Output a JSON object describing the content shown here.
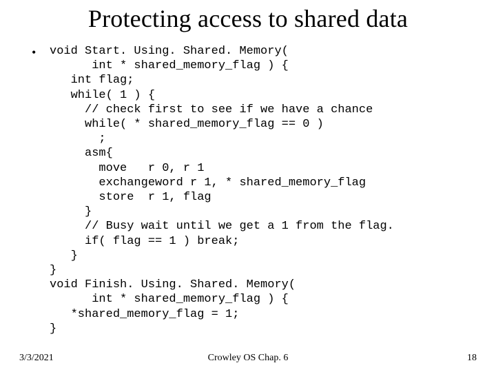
{
  "title": "Protecting access to shared data",
  "bullet": "•",
  "code": "void Start. Using. Shared. Memory(\n      int * shared_memory_flag ) {\n   int flag;\n   while( 1 ) {\n     // check first to see if we have a chance\n     while( * shared_memory_flag == 0 )\n       ;\n     asm{\n       move   r 0, r 1\n       exchangeword r 1, * shared_memory_flag\n       store  r 1, flag\n     }\n     // Busy wait until we get a 1 from the flag.\n     if( flag == 1 ) break;\n   }\n}\nvoid Finish. Using. Shared. Memory(\n      int * shared_memory_flag ) {\n   *shared_memory_flag = 1;\n}",
  "footer": {
    "date": "3/3/2021",
    "center": "Crowley     OS      Chap. 6",
    "page": "18"
  }
}
